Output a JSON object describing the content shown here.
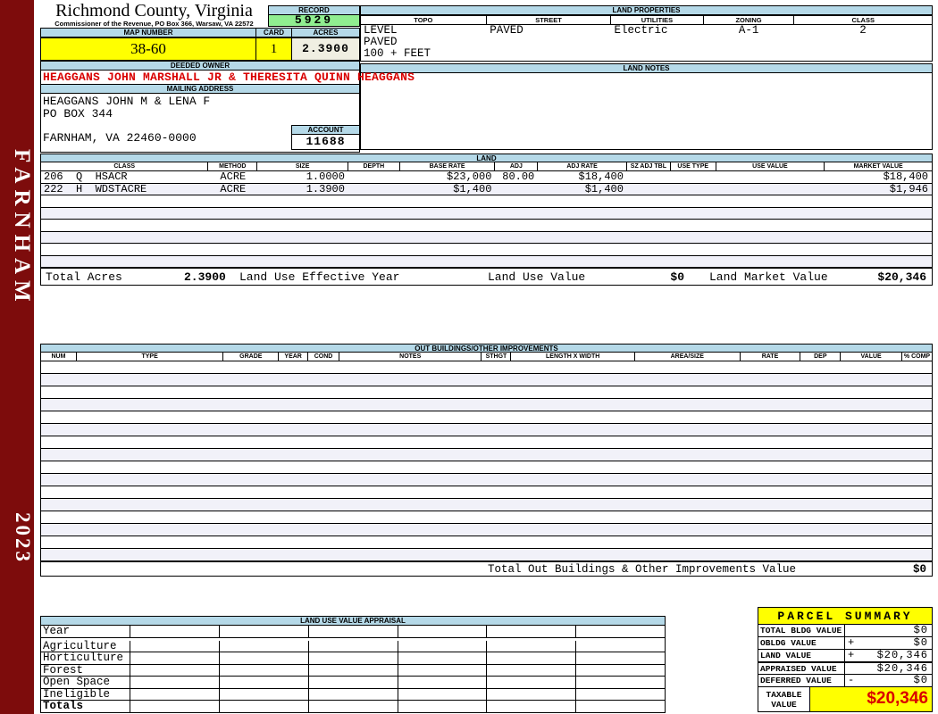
{
  "county": {
    "title": "Richmond County, Virginia",
    "subtitle": "Commissioner of the Revenue, PO Box 366, Warsaw, VA 22572"
  },
  "sidebar": {
    "district": "FARNHAM",
    "year": "2023"
  },
  "record": {
    "label": "RECORD",
    "value": "5929"
  },
  "map": {
    "label": "MAP NUMBER",
    "value": "38-60"
  },
  "card": {
    "label": "CARD",
    "value": "1"
  },
  "acres": {
    "label": "ACRES",
    "value": "2.3900"
  },
  "land_properties": {
    "title": "LAND PROPERTIES",
    "columns": [
      "TOPO",
      "STREET",
      "UTILITIES",
      "ZONING",
      "CLASS"
    ],
    "body": [
      [
        "LEVEL",
        "PAVED",
        "Electric",
        "A-1",
        "2"
      ],
      [
        "PAVED",
        "",
        "",
        "",
        ""
      ],
      [
        "100 + FEET",
        "",
        "",
        "",
        ""
      ]
    ]
  },
  "owner": {
    "label": "DEEDED OWNER",
    "value": "HEAGGANS JOHN MARSHALL JR & THERESITA QUINN HEAGGANS"
  },
  "mailing": {
    "label": "MAILING ADDRESS",
    "lines": [
      "HEAGGANS JOHN M & LENA F",
      "PO BOX 344",
      "",
      "FARNHAM, VA 22460-0000"
    ]
  },
  "account": {
    "label": "ACCOUNT",
    "value": "11688"
  },
  "land_notes": {
    "label": "LAND NOTES"
  },
  "land": {
    "title": "LAND",
    "columns": [
      "CLASS",
      "METHOD",
      "SIZE",
      "DEPTH",
      "BASE RATE",
      "ADJ",
      "ADJ RATE",
      "SZ ADJ TBL",
      "USE TYPE",
      "USE VALUE",
      "MARKET VALUE"
    ],
    "align": [
      "l",
      "c",
      "r",
      "c",
      "r",
      "r",
      "r",
      "c",
      "c",
      "r",
      "r"
    ],
    "rows": [
      [
        "206  Q  HSACR",
        "ACRE",
        "1.0000",
        "",
        "$23,000",
        "80.00",
        "$18,400",
        "",
        "",
        "",
        "$18,400"
      ],
      [
        "222  H  WDSTACRE",
        "ACRE",
        "1.3900",
        "",
        "$1,400",
        "",
        "$1,400",
        "",
        "",
        "",
        "$1,946"
      ]
    ],
    "empty_rows": 6,
    "totals": {
      "total_acres_label": "Total Acres",
      "total_acres": "2.3900",
      "effective_year_label": "Land Use Effective Year",
      "use_value_label": "Land Use Value",
      "use_value": "$0",
      "market_value_label": "Land Market Value",
      "market_value": "$20,346"
    }
  },
  "out_buildings": {
    "title": "OUT BUILDINGS/OTHER IMPROVEMENTS",
    "columns": [
      "NUM",
      "TYPE",
      "GRADE",
      "YEAR",
      "COND",
      "NOTES",
      "STHGT",
      "LENGTH X WIDTH",
      "AREA/SIZE",
      "RATE",
      "DEP",
      "VALUE",
      "% COMP"
    ],
    "empty_rows": 16,
    "total_label": "Total Out Buildings & Other Improvements Value",
    "total_value": "$0"
  },
  "land_use_appraisal": {
    "title": "LAND USE VALUE APPRAISAL",
    "row_labels": [
      "Year",
      "Agriculture",
      "Horticulture",
      "Forest",
      "Open Space",
      "Ineligible",
      "Totals"
    ],
    "data_columns": 6
  },
  "parcel_summary": {
    "title": "PARCEL SUMMARY",
    "rows": [
      {
        "label": "TOTAL BLDG VALUE",
        "sign": "",
        "value": "$0"
      },
      {
        "label": "OBLDG VALUE",
        "sign": "+",
        "value": "$0"
      },
      {
        "label": "LAND VALUE",
        "sign": "+",
        "value": "$20,346"
      },
      {
        "label": "APPRAISED VALUE",
        "sign": "",
        "value": "$20,346"
      },
      {
        "label": "DEFERRED VALUE",
        "sign": "-",
        "value": "$0"
      }
    ],
    "taxable": {
      "label": "TAXABLE\nVALUE",
      "value": "$20,346"
    }
  },
  "colors": {
    "sidebar_maroon": "#7D0C0C",
    "header_blue": "#B5D9E8",
    "record_green": "#90EE90",
    "highlight_yellow": "#FFFF00",
    "acres_cream": "#F0EFE2",
    "owner_red": "#D90000",
    "taxable_red": "#D90000",
    "row_alt": "#F1F1F9"
  }
}
